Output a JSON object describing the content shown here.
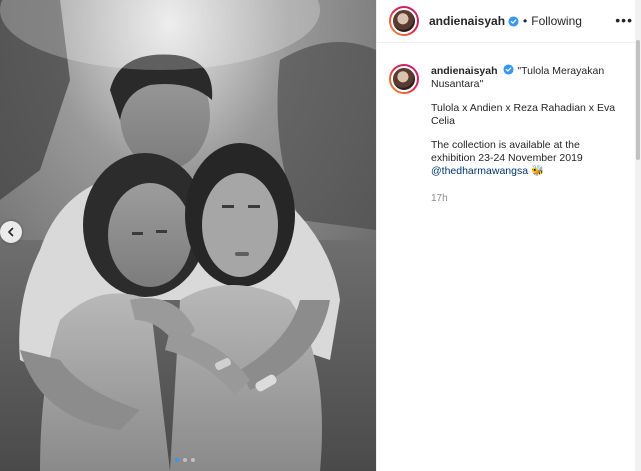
{
  "header": {
    "username": "andienaisyah",
    "separator": "•",
    "follow_status": "Following",
    "more_icon": "more-options-icon"
  },
  "caption": {
    "username": "andienaisyah",
    "title": "\"Tulola Merayakan Nusantara\"",
    "credits": "Tulola x Andien x Reza Rahadian x Eva Celia",
    "body": "The collection is available at the exhibition 23-24 November 2019",
    "mention": "@thedharmawangsa",
    "emoji": "🐝",
    "timestamp": "17h"
  },
  "carousel": {
    "prev_icon": "chevron-left-icon",
    "slide_count": 3,
    "active_index": 0
  },
  "colors": {
    "link": "#00376b",
    "verified": "#3897f0",
    "muted": "#8e8e8e"
  }
}
